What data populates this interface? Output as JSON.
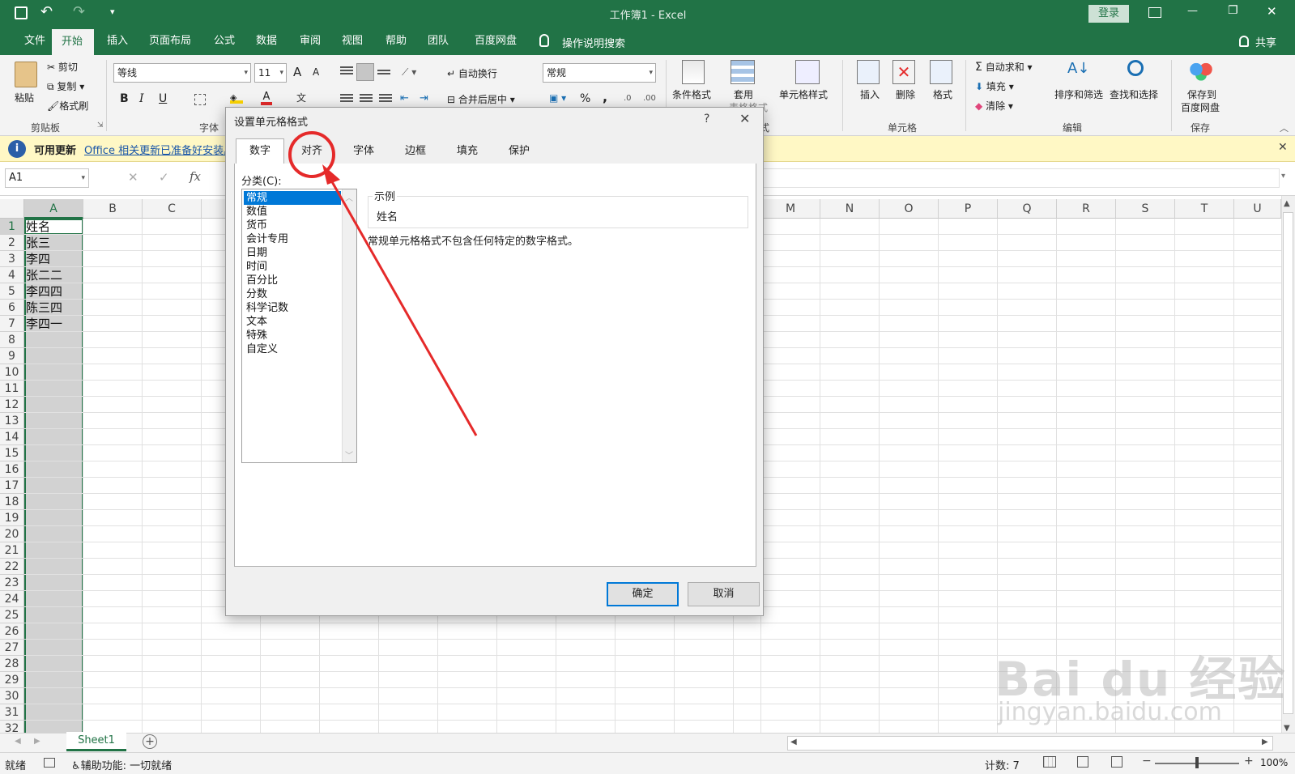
{
  "title_bar": {
    "title": "工作簿1 - Excel",
    "login": "登录",
    "minimize": "—",
    "restore": "❐",
    "close": "✕"
  },
  "ribbon_tabs": [
    "文件",
    "开始",
    "插入",
    "页面布局",
    "公式",
    "数据",
    "审阅",
    "视图",
    "帮助",
    "团队",
    "百度网盘"
  ],
  "search_hint": "操作说明搜索",
  "share": "共享",
  "clipboard": {
    "paste": "粘贴",
    "cut": "剪切",
    "copy": "复制",
    "format_painter": "格式刷",
    "label": "剪贴板"
  },
  "font": {
    "name": "等线",
    "size": "11",
    "bold": "B",
    "italic": "I",
    "underline": "U",
    "grow": "A",
    "shrink": "A",
    "label": "字体"
  },
  "alignment": {
    "wrap": "自动换行",
    "merge": "合并后居中"
  },
  "number": {
    "format": "常规",
    "percent": "%",
    "comma": ","
  },
  "styles": {
    "conditional": "条件格式",
    "table_line1": "套用",
    "table_line2": "表格格式",
    "cell_styles": "单元格样式",
    "label_suffix": "式"
  },
  "cells": {
    "insert": "插入",
    "delete": "删除",
    "format": "格式",
    "label": "单元格"
  },
  "editing": {
    "autosum": "自动求和",
    "fill": "填充",
    "clear": "清除",
    "sort": "排序和筛选",
    "find": "查找和选择",
    "label": "编辑"
  },
  "save_group": {
    "save_line1": "保存到",
    "save_line2": "百度网盘",
    "label": "保存"
  },
  "info": {
    "title": "可用更新",
    "message": "Office 相关更新已准备好安装。"
  },
  "formula_bar": {
    "name_box": "A1",
    "fx": "fx"
  },
  "columns": [
    "A",
    "B",
    "C",
    "M",
    "N",
    "O",
    "P",
    "Q",
    "R",
    "S",
    "T",
    "U"
  ],
  "rows": [
    "1",
    "2",
    "3",
    "4",
    "5",
    "6",
    "7",
    "8",
    "9",
    "10",
    "11",
    "12",
    "13",
    "14",
    "15",
    "16",
    "17",
    "18",
    "19",
    "20",
    "21",
    "22",
    "23",
    "24",
    "25",
    "26",
    "27",
    "28",
    "29",
    "30",
    "31",
    "32"
  ],
  "cell_values": [
    "姓名",
    "张三",
    "李四",
    "张二二",
    "李四四",
    "陈三四",
    "李四一"
  ],
  "dialog": {
    "title": "设置单元格格式",
    "help": "?",
    "close": "✕",
    "tabs": [
      "数字",
      "对齐",
      "字体",
      "边框",
      "填充",
      "保护"
    ],
    "category_label": "分类(C):",
    "categories": [
      "常规",
      "数值",
      "货币",
      "会计专用",
      "日期",
      "时间",
      "百分比",
      "分数",
      "科学记数",
      "文本",
      "特殊",
      "自定义"
    ],
    "sample_label": "示例",
    "sample_value": "姓名",
    "description": "常规单元格格式不包含任何特定的数字格式。",
    "ok": "确定",
    "cancel": "取消"
  },
  "sheet_tab": "Sheet1",
  "status": {
    "ready": "就绪",
    "accessibility": "辅助功能: 一切就绪",
    "count": "计数: 7",
    "zoom": "100%"
  },
  "watermark": {
    "brand": "Bai du 经验",
    "url": "jingyan.baidu.com"
  },
  "colors": {
    "excel_green": "#217346",
    "selection": "#0078d7",
    "annotation": "#e52a2a",
    "info_bg": "#fff8c5"
  }
}
